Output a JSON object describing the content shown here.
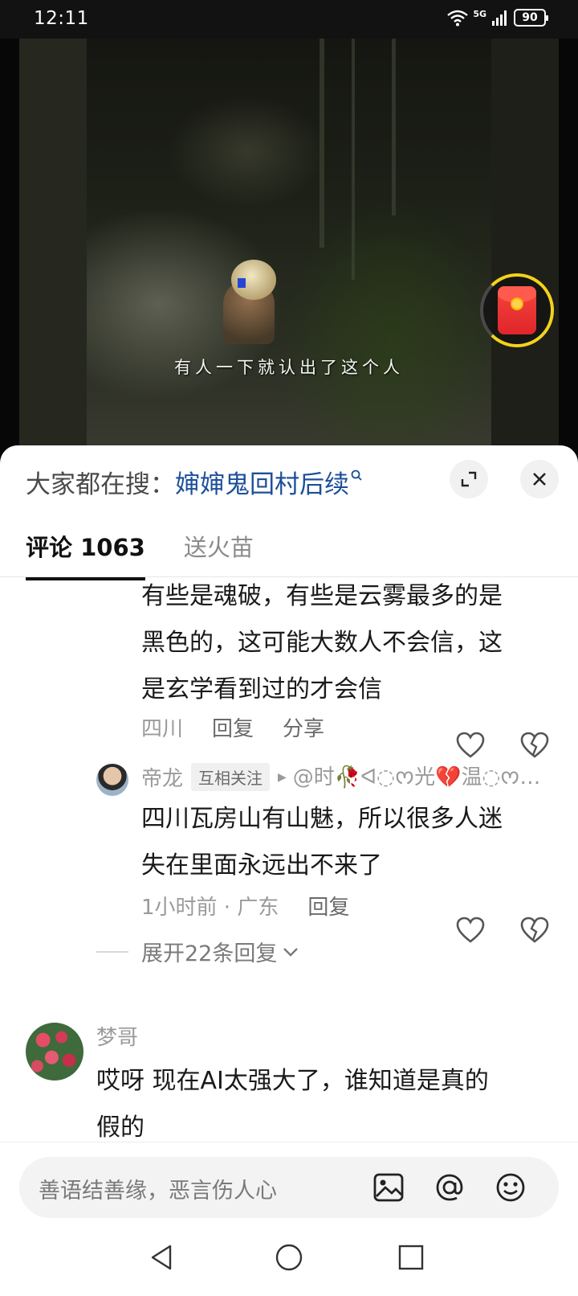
{
  "status_bar": {
    "time": "12:11",
    "network": "5G",
    "battery": "90"
  },
  "video": {
    "subtitle": "有人一下就认出了这个人"
  },
  "search_bar": {
    "prefix": "大家都在搜：",
    "query": "婶婶鬼回村后续"
  },
  "tabs": [
    {
      "label": "评论 1063",
      "active": true
    },
    {
      "label": "送火苗",
      "active": false
    }
  ],
  "comments": {
    "first": {
      "lines": [
        "有些是魂破，有些是云雾最多的是",
        "黑色的，这可能大数人不会信，这",
        "是玄学看到过的才会信"
      ],
      "location": "四川",
      "reply_label": "回复",
      "share_label": "分享"
    },
    "reply": {
      "username": "帝龙",
      "tag": "互相关注",
      "reply_to": "@时🥀ᐊ◌ᰔ光💔温◌ᰔ…",
      "lines": [
        "四川瓦房山有山魅，所以很多人迷",
        "失在里面永远出不来了"
      ],
      "time_location": "1小时前 · 广东",
      "reply_label": "回复"
    },
    "expand_replies": "展开22条回复",
    "second": {
      "username": "梦哥",
      "lines": [
        "哎呀 现在AI太强大了，谁知道是真的",
        "假的"
      ]
    }
  },
  "input": {
    "placeholder": "善语结善缘，恶言伤人心"
  },
  "colors": {
    "link": "#1c4f9a",
    "accent_ring": "#f3d21a",
    "envelope_red": "#e0252b"
  }
}
